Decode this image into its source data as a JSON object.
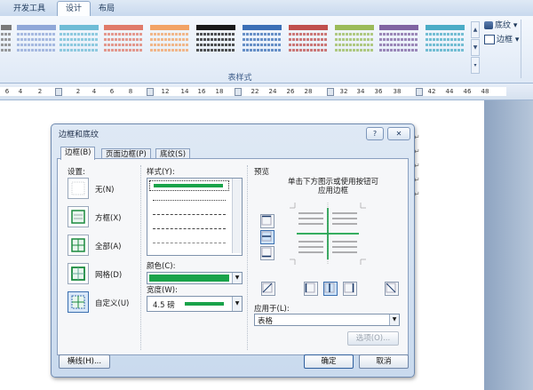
{
  "ribbon": {
    "tabs": [
      {
        "label": "开发工具",
        "active": false
      },
      {
        "label": "设计",
        "active": true
      },
      {
        "label": "布局",
        "active": false
      }
    ],
    "table_styles_group_label": "表样式",
    "shading_label": "底纹",
    "borders_label": "边框",
    "style_accent_colors": [
      "#7a7a7a",
      "#8fa7d8",
      "#9bb7e0",
      "#e07b6a",
      "#9bc86a",
      "#9b88c8",
      "#6fbcd6",
      "#f2a365",
      "#1a1a1a",
      "#3b6fb6",
      "#c0504d",
      "#9bbb59",
      "#8064a2",
      "#4bacc6"
    ]
  },
  "ruler": {
    "numbers": [
      "6",
      "4",
      "2",
      "2",
      "4",
      "6",
      "8",
      "12",
      "14",
      "16",
      "18",
      "22",
      "24",
      "26",
      "28",
      "32",
      "34",
      "36",
      "38",
      "42",
      "44",
      "46",
      "48"
    ]
  },
  "dialog": {
    "title": "边框和底纹",
    "help": "?",
    "close": "✕",
    "tabs": [
      {
        "label": "边框(B)",
        "active": true
      },
      {
        "label": "页面边框(P)",
        "active": false
      },
      {
        "label": "底纹(S)",
        "active": false
      }
    ],
    "settings": {
      "label": "设置:",
      "options": [
        {
          "label": "无(N)",
          "selected": false
        },
        {
          "label": "方框(X)",
          "selected": false
        },
        {
          "label": "全部(A)",
          "selected": false
        },
        {
          "label": "网格(D)",
          "selected": false
        },
        {
          "label": "自定义(U)",
          "selected": true
        }
      ]
    },
    "style": {
      "label": "样式(Y):"
    },
    "color": {
      "label": "颜色(C):",
      "value": "#1aa34a"
    },
    "width": {
      "label": "宽度(W):",
      "value": "4.5 磅"
    },
    "preview": {
      "label": "预览",
      "hint_line1": "单击下方图示或使用按钮可",
      "hint_line2": "应用边框"
    },
    "apply_to": {
      "label": "应用于(L):",
      "value": "表格"
    },
    "options_button": "选项(O)...",
    "horizontal_line_button": "横线(H)...",
    "ok_button": "确定",
    "cancel_button": "取消"
  }
}
